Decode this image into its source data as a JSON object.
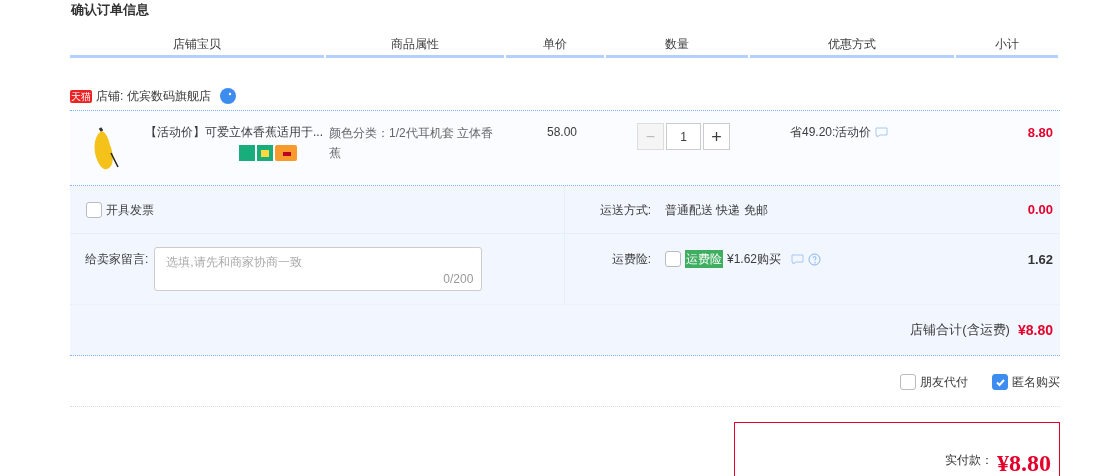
{
  "title": "确认订单信息",
  "columns": [
    "店铺宝贝",
    "商品属性",
    "单价",
    "数量",
    "优惠方式",
    "小计"
  ],
  "store": {
    "name": "店铺: 优宾数码旗舰店",
    "badge": "天猫"
  },
  "item": {
    "title": "【活动价】可爱立体香蕉适用于...",
    "attribute": "颜色分类：1/2代耳机套 立体香蕉",
    "price": "58.00",
    "quantity": "1",
    "minus": "−",
    "plus": "+",
    "discount": "省49.20:活动价",
    "subtotal": "8.80"
  },
  "invoice": {
    "label": "开具发票",
    "checked": false
  },
  "message": {
    "label": "给卖家留言:",
    "placeholder": "选填,请先和商家协商一致",
    "counter": "0/200"
  },
  "shipping": {
    "label": "运送方式:",
    "value": "普通配送 快递 免邮",
    "amount": "0.00"
  },
  "insurance": {
    "label": "运费险:",
    "checked": false,
    "tag": "运费险",
    "value": "¥1.62购买",
    "amount": "1.62"
  },
  "store_total": {
    "label": "店铺合计(含运费)",
    "amount": "¥8.80"
  },
  "options": [
    {
      "label": "朋友代付",
      "checked": false
    },
    {
      "label": "匿名购买",
      "checked": true
    }
  ],
  "pay": {
    "label": "实付款：",
    "amount": "¥8.80"
  }
}
